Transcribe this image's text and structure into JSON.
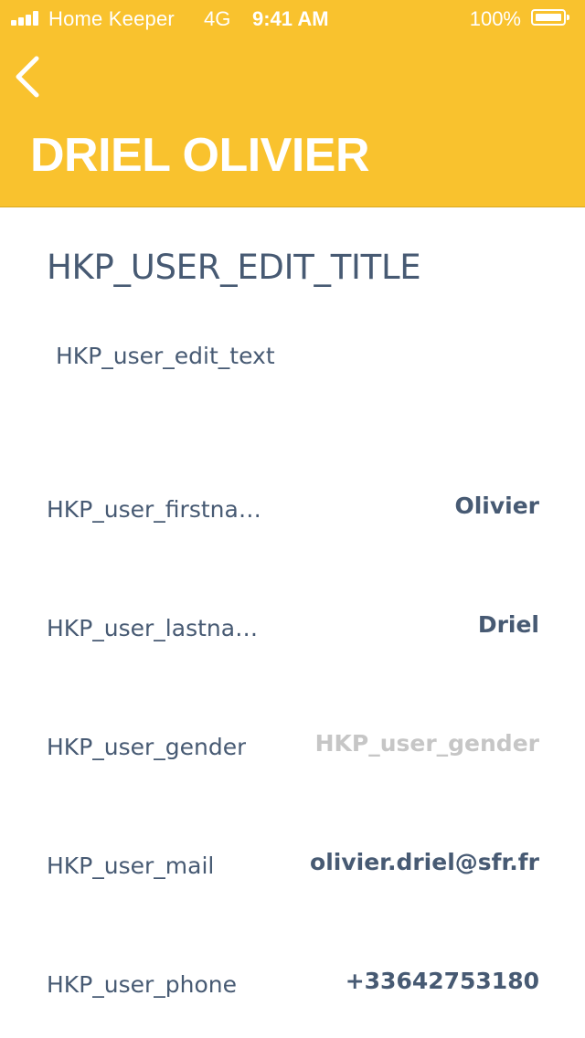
{
  "status_bar": {
    "carrier": "Home Keeper",
    "network": "4G",
    "time": "9:41 AM",
    "battery": "100%"
  },
  "header": {
    "back_icon": "chevron-left-icon",
    "title": "DRIEL OLIVIER"
  },
  "section": {
    "title": "HKP_USER_EDIT_TITLE",
    "text": "HKP_user_edit_text"
  },
  "fields": [
    {
      "label": "HKP_user_firstname",
      "value": "Olivier"
    },
    {
      "label": "HKP_user_lastname",
      "value": "Driel"
    },
    {
      "label": "HKP_user_gender",
      "placeholder": "HKP_user_gender"
    },
    {
      "label": "HKP_user_mail",
      "value": "olivier.driel@sfr.fr"
    },
    {
      "label": "HKP_user_phone",
      "value": "+33642753180"
    }
  ],
  "colors": {
    "header_background": "#F9C22E",
    "text_primary": "#475A73",
    "placeholder": "#C6C6C6",
    "header_text": "#FFFFFF"
  }
}
